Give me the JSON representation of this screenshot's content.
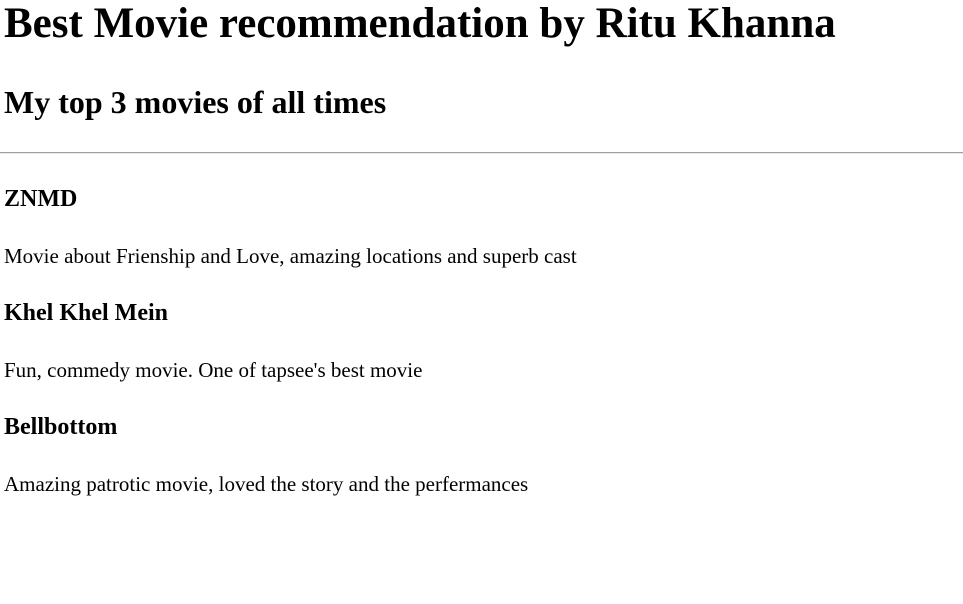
{
  "header": {
    "title": "Best Movie recommendation by Ritu Khanna",
    "subtitle": "My top 3 movies of all times"
  },
  "movies": [
    {
      "title": "ZNMD",
      "description": "Movie about Frienship and Love, amazing locations and superb cast"
    },
    {
      "title": "Khel Khel Mein",
      "description": "Fun, commedy movie. One of tapsee's best movie"
    },
    {
      "title": "Bellbottom",
      "description": "Amazing patrotic movie, loved the story and the perfermances"
    }
  ]
}
